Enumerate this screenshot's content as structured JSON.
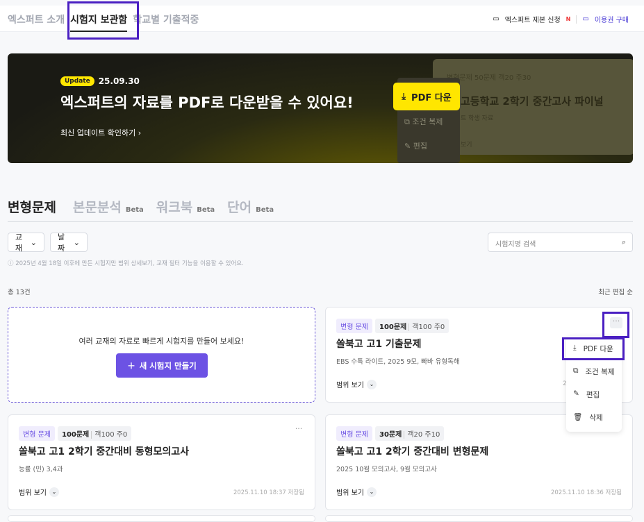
{
  "nav": {
    "items": [
      "엑스퍼트 소개",
      "시험지 보관함",
      "학교별 기출적중"
    ],
    "active": 1,
    "expert_apply": "엑스퍼트 제본 신청",
    "new_badge": "N",
    "buy": "이용권 구매"
  },
  "banner": {
    "update_badge": "Update",
    "update_date": "25.09.30",
    "title": "엑스퍼트의 자료를 PDF로 다운받을 수 있어요!",
    "link": "최신 업데이트 확인하기",
    "pdf_button": "PDF 다운",
    "menu": [
      "조건 복제",
      "편집"
    ],
    "mock": {
      "tags": "변형문제   50문제  객20 주30",
      "title": "고등학교 2학기 중간고사 파이널",
      "sub": "트 학생 자료",
      "range": "보기"
    }
  },
  "tabs": [
    {
      "label": "변형문제",
      "beta": ""
    },
    {
      "label": "본문분석",
      "beta": "Beta"
    },
    {
      "label": "워크북",
      "beta": "Beta"
    },
    {
      "label": "단어",
      "beta": "Beta"
    }
  ],
  "filters": {
    "textbook": "교재",
    "date": "날짜",
    "search_placeholder": "시험지명 검색"
  },
  "notice": "ⓘ 2025년 4월 18일 이후에 만든 시험지만 범위 상세보기, 교재 필터 기능을 이용할 수 있어요.",
  "total": "총 13건",
  "sort": "최근 편집 순",
  "new_card": {
    "text": "여러 교재의 자료로 빠르게 시험지를 만들어 보세요!",
    "button": "새 시험지 만들기"
  },
  "cards": [
    {
      "type": "변형 문제",
      "count": "100문제",
      "detail": "객100 주0",
      "title": "쏠북고 고1 기출문제",
      "sub": "EBS 수특 라이트, 2025 9모, 빠바 유형독해",
      "range": "범위 보기",
      "date": "20"
    },
    {
      "type": "변형 문제",
      "count": "100문제",
      "detail": "객100 주0",
      "title": "쏠북고 고1 2학기 중간대비 동형모의고사",
      "sub": "능률 (민) 3,4과",
      "range": "범위 보기",
      "date": "2025.11.10 18:37 저장됨"
    },
    {
      "type": "변형 문제",
      "count": "30문제",
      "detail": "객20 주10",
      "title": "쏠북고 고1 2학기 중간대비 변형문제",
      "sub": "2025 10월 모의고사, 9월 모의고사",
      "range": "범위 보기",
      "date": "2025.11.10 18:36 저장됨"
    }
  ],
  "dropdown": [
    "PDF 다운",
    "조건 복제",
    "편집",
    "삭제"
  ],
  "colors": {
    "accent": "#6c52e4",
    "banner_yellow": "#ffe600",
    "highlight": "#4a1fc2"
  }
}
